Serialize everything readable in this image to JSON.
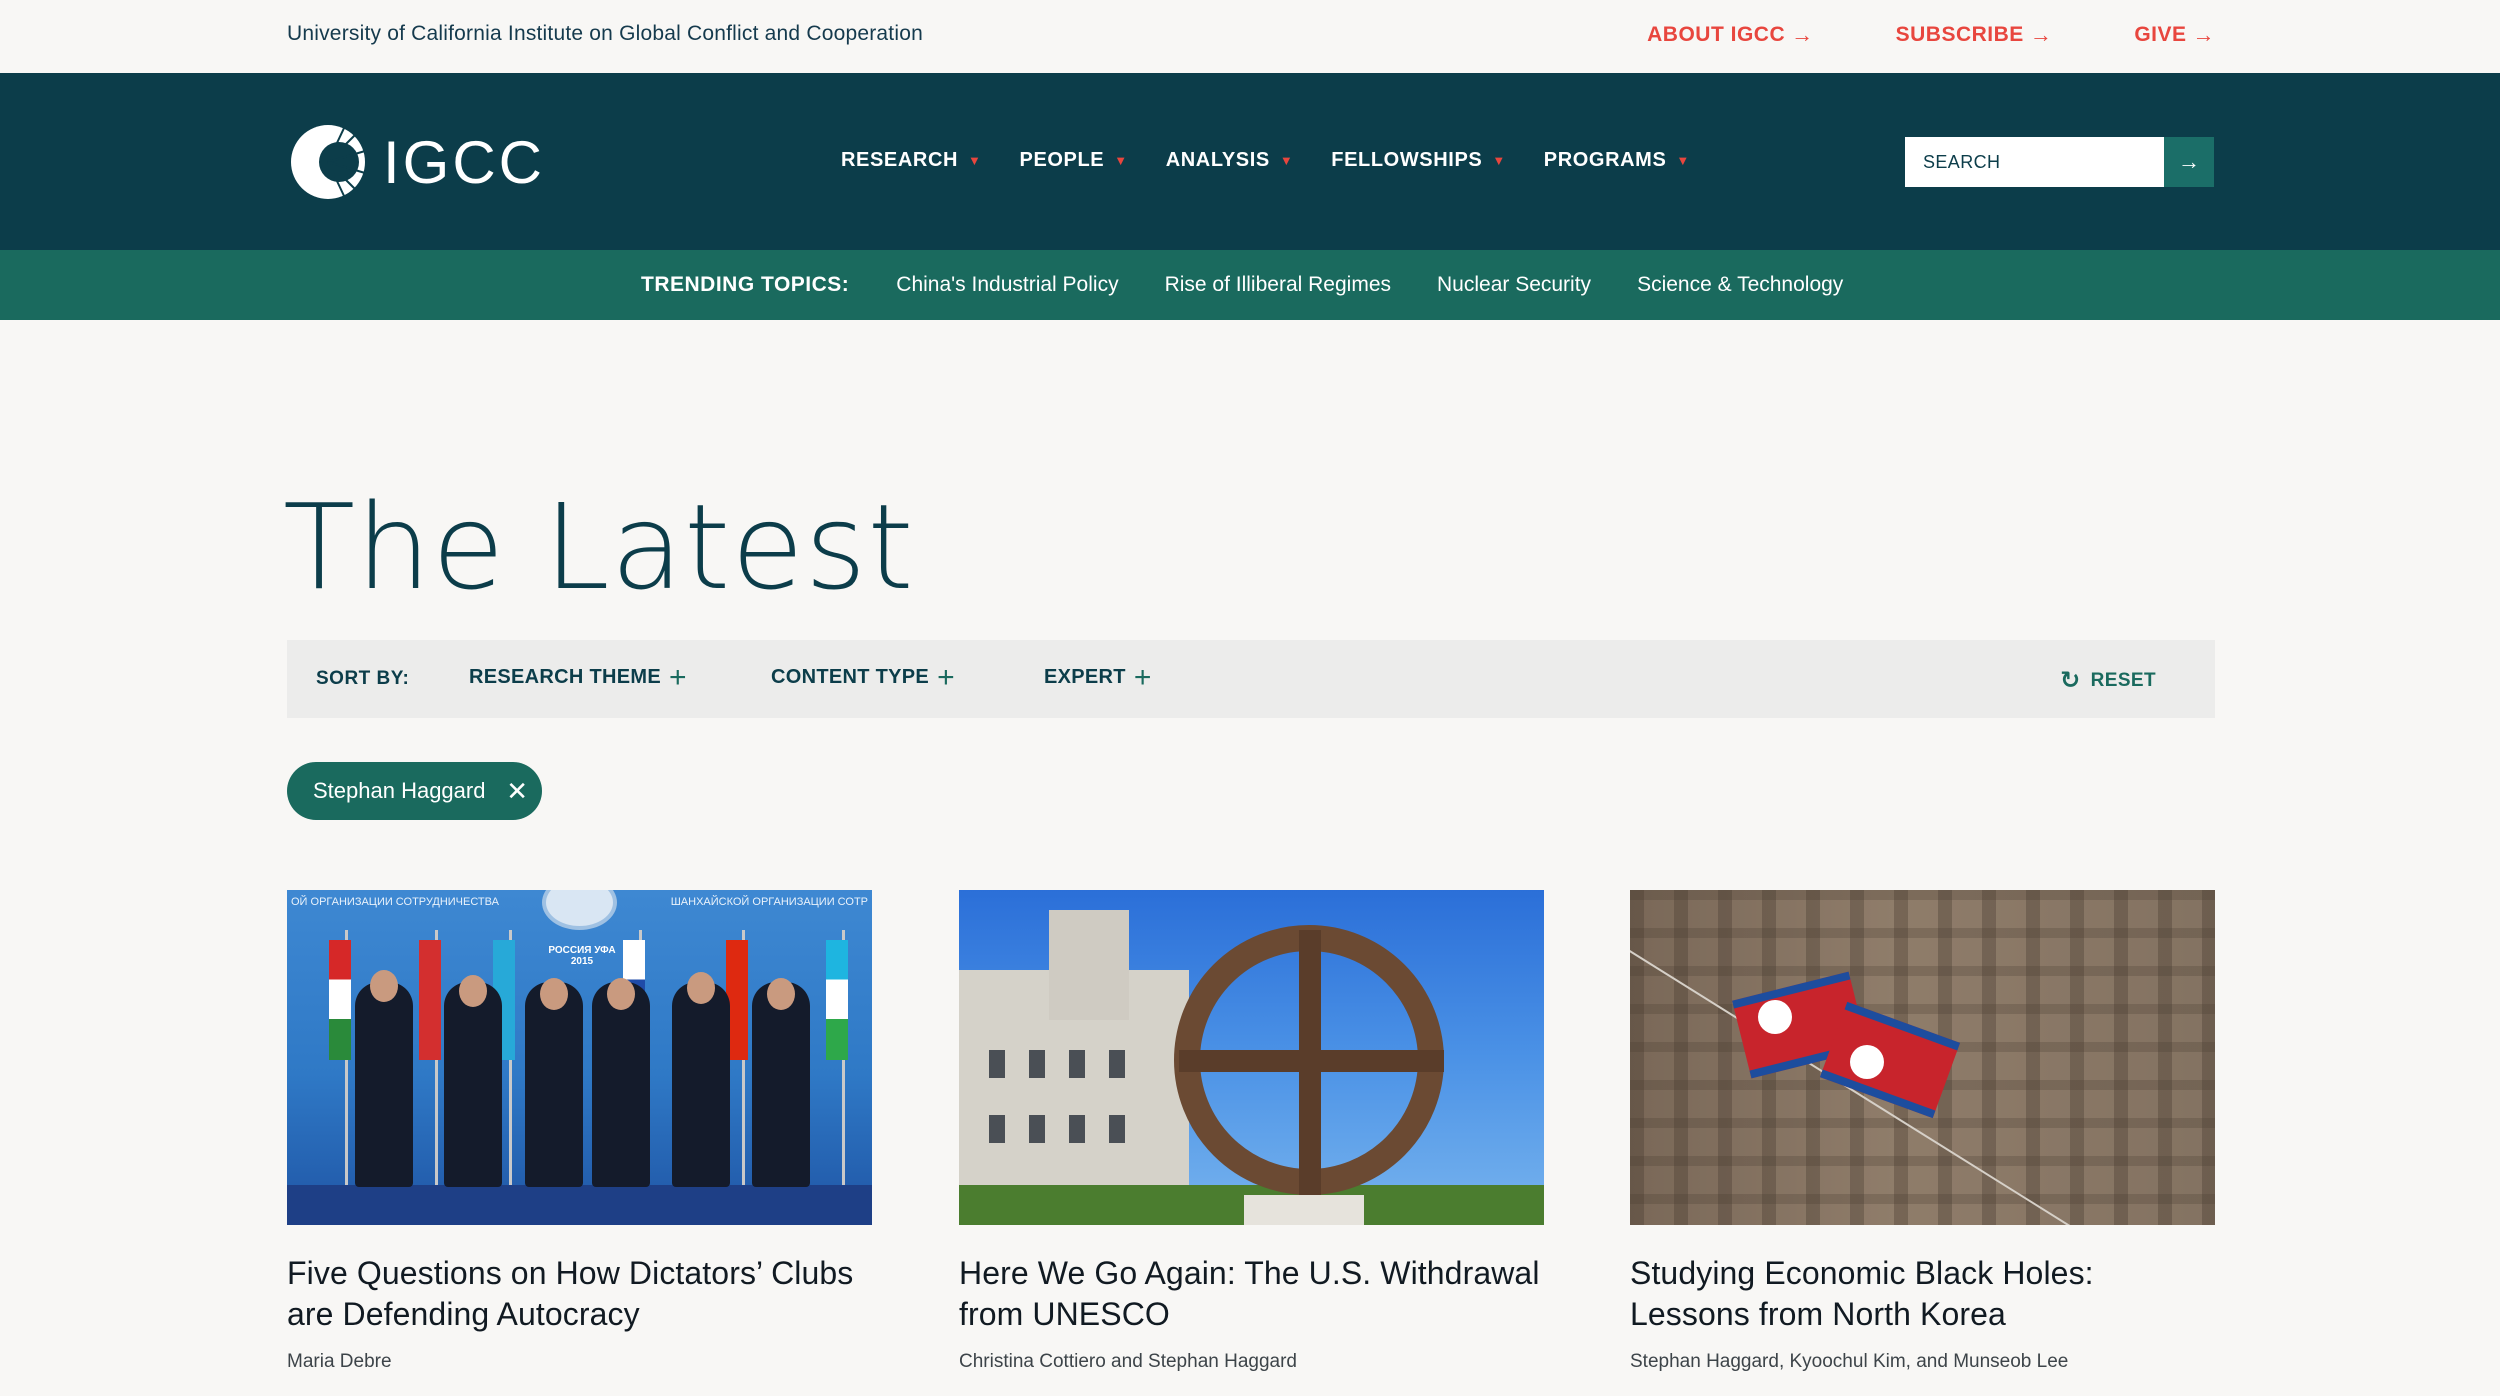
{
  "utility": {
    "org_name": "University of California Institute on Global Conflict and Cooperation",
    "links": [
      "ABOUT IGCC",
      "SUBSCRIBE",
      "GIVE"
    ]
  },
  "logo": {
    "wordmark": "IGCC"
  },
  "nav": {
    "items": [
      "RESEARCH",
      "PEOPLE",
      "ANALYSIS",
      "FELLOWSHIPS",
      "PROGRAMS"
    ],
    "search_placeholder": "SEARCH"
  },
  "trending": {
    "label": "TRENDING TOPICS:",
    "topics": [
      "China's Industrial Policy",
      "Rise of Illiberal Regimes",
      "Nuclear Security",
      "Science & Technology"
    ]
  },
  "page": {
    "title": "The Latest"
  },
  "sortbar": {
    "label": "SORT BY:",
    "filters": [
      "RESEARCH THEME",
      "CONTENT TYPE",
      "EXPERT"
    ],
    "reset": "RESET"
  },
  "active_tag": "Stephan Haggard",
  "cards": [
    {
      "title": "Five Questions on How Dictators’ Clubs are Defending Autocracy",
      "author": "Maria Debre",
      "banner_left": "ОЙ ОРГАНИЗАЦИИ СОТРУДНИЧЕСТВА",
      "banner_right": "ШАНХАЙСКОЙ ОРГАНИЗАЦИИ СОТР",
      "sign": "РОССИЯ УФА 2015"
    },
    {
      "title": "Here We Go Again: The U.S. Withdrawal from UNESCO",
      "author": "Christina Cottiero and Stephan Haggard"
    },
    {
      "title": "Studying Economic Black Holes: Lessons from North Korea",
      "author": "Stephan Haggard, Kyoochul Kim, and Munseob Lee"
    }
  ],
  "colors": {
    "navy": "#0c3d4a",
    "teal": "#1a6a5e",
    "accent_red": "#e8463e",
    "page_bg": "#f8f7f5"
  }
}
